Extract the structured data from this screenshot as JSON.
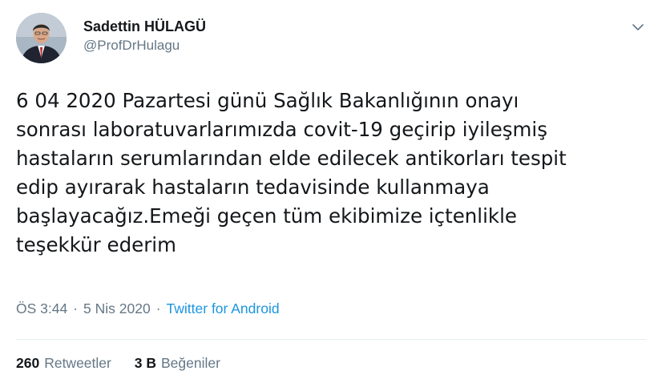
{
  "author": {
    "name": "Sadettin HÜLAGÜ",
    "handle": "@ProfDrHulagu"
  },
  "tweet": {
    "lines": [
      "6 04 2020 Pazartesi günü Sağlık Bakanlığının onayı",
      "sonrası laboratuvarlarımızda covit-19 geçirip iyileşmiş",
      "hastaların serumlarından elde edilecek antikorları tespit",
      "edip ayırarak hastaların tedavisinde kullanmaya",
      "başlayacağız.Emeği geçen tüm ekibimize içtenlikle",
      "teşekkür ederim"
    ]
  },
  "meta": {
    "time": "ÖS 3:44",
    "separator": "·",
    "date": "5 Nis 2020",
    "source": "Twitter for Android"
  },
  "stats": {
    "retweets_count": "260",
    "retweets_label": "Retweetler",
    "likes_count": "3 B",
    "likes_label": "Beğeniler"
  },
  "colors": {
    "text": "#14171a",
    "secondary": "#657786",
    "link": "#1b95e0",
    "divider": "#e6ecf0"
  },
  "icons": {
    "menu": "chevron-down-icon"
  }
}
